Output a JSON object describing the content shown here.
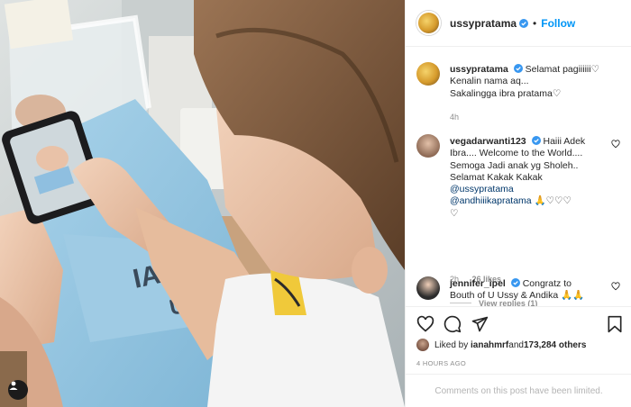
{
  "post": {
    "username": "ussypratama",
    "follow_label": "Follow",
    "dot": "•"
  },
  "caption": {
    "username": "ussypratama",
    "line1": "Selamat pagiiiiii♡",
    "line2": "Kenalin nama aq...",
    "line3": "Sakalingga ibra pratama♡",
    "time": "4h"
  },
  "comments": [
    {
      "username": "vegadarwanti123",
      "text_lines": [
        "Haiii Adek",
        "Ibra.... Welcome to the World....",
        "Semoga Jadi anak yg Sholeh..",
        "Selamat Kakak Kakak"
      ],
      "mentions": [
        "@ussypratama",
        "@andhiiikapratama"
      ],
      "tail": " 🙏♡♡♡",
      "tail2": "♡",
      "time": "2h",
      "likes": "26 likes",
      "view_replies": "View replies (1)"
    },
    {
      "username": "jennifer_ipel",
      "text_lines": [
        "Congratz to",
        "Bouth of U Ussy & Andika 🙏🙏"
      ]
    }
  ],
  "likes": {
    "prefix": "Liked by ",
    "user": "ianahmrf",
    "mid": " and ",
    "count": "173,284 others"
  },
  "timestamp": "4 HOURS AGO",
  "comments_limited": "Comments on this post have been limited.",
  "icons": [
    "heart-icon",
    "comment-icon",
    "share-icon",
    "bookmark-icon",
    "verified-icon",
    "user-tag-icon"
  ],
  "colors": {
    "accent": "#0095f6",
    "verified": "#3897f0",
    "muted": "#8e8e8e"
  }
}
